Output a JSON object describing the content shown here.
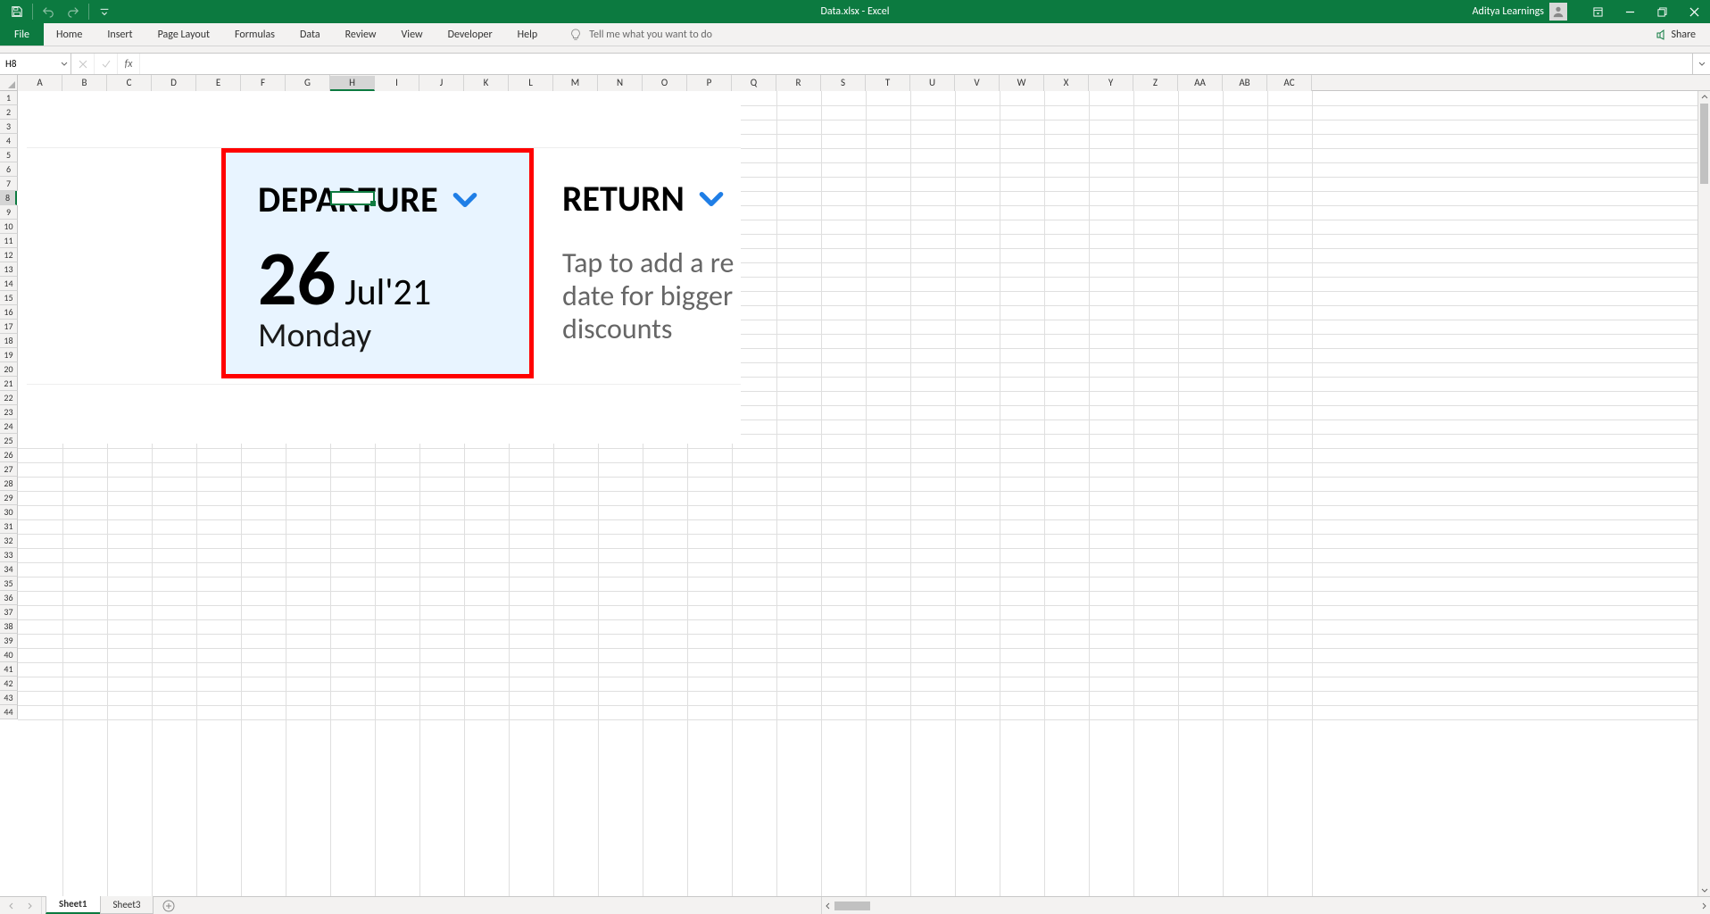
{
  "titlebar": {
    "doc_title": "Data.xlsx - Excel",
    "user_name": "Aditya Learnings"
  },
  "ribbon": {
    "tabs": [
      "File",
      "Home",
      "Insert",
      "Page Layout",
      "Formulas",
      "Data",
      "Review",
      "View",
      "Developer",
      "Help"
    ],
    "tell_me_placeholder": "Tell me what you want to do",
    "share_label": "Share"
  },
  "formulabar": {
    "namebox_value": "H8",
    "fx_label": "fx",
    "formula_value": ""
  },
  "grid": {
    "columns": [
      "A",
      "B",
      "C",
      "D",
      "E",
      "F",
      "G",
      "H",
      "I",
      "J",
      "K",
      "L",
      "M",
      "N",
      "O",
      "P",
      "Q",
      "R",
      "S",
      "T",
      "U",
      "V",
      "W",
      "X",
      "Y",
      "Z",
      "AA",
      "AB",
      "AC"
    ],
    "active_column_index": 7,
    "row_count": 44,
    "active_row": 8
  },
  "embedded_widget": {
    "departure": {
      "label": "DEPARTURE",
      "day": "26",
      "month_year": "Jul'21",
      "day_of_week": "Monday"
    },
    "return": {
      "label": "RETURN",
      "tap_text_line1": "Tap to add a re",
      "tap_text_line2": "date for bigger",
      "tap_text_line3": "discounts"
    }
  },
  "sheetbar": {
    "tabs": [
      {
        "name": "Sheet1",
        "active": true
      },
      {
        "name": "Sheet3",
        "active": false
      }
    ]
  }
}
